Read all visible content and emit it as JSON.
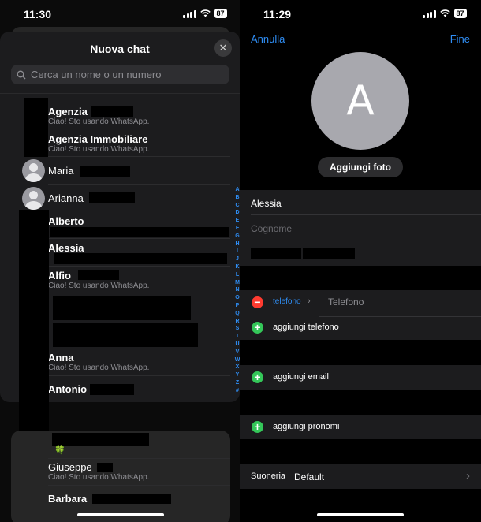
{
  "left_screen": {
    "status": {
      "time": "11:30",
      "battery": "87"
    },
    "sheet": {
      "title": "Nuova chat",
      "close_symbol": "✕",
      "search_placeholder": "Cerca un nome o un numero"
    },
    "contacts": [
      {
        "name": "Agenzia",
        "status": "Ciao! Sto usando WhatsApp."
      },
      {
        "name": "Agenzia Immobiliare",
        "status": "Ciao! Sto usando WhatsApp."
      },
      {
        "name": "Maria"
      },
      {
        "name": "Arianna"
      },
      {
        "name": "Alberto"
      },
      {
        "name": "Alessia"
      },
      {
        "name": "Alfio",
        "status": "Ciao! Sto usando WhatsApp."
      },
      {
        "name": "Anna",
        "status": "Ciao! Sto usando WhatsApp."
      },
      {
        "name": "Antonio"
      }
    ],
    "index_letters": [
      "A",
      "B",
      "C",
      "D",
      "E",
      "F",
      "G",
      "H",
      "I",
      "J",
      "K",
      "L",
      "M",
      "N",
      "O",
      "P",
      "Q",
      "R",
      "S",
      "T",
      "U",
      "V",
      "W",
      "X",
      "Y",
      "Z",
      "#"
    ],
    "below": [
      {
        "name": "Giuseppe",
        "status": "Ciao! Sto usando WhatsApp."
      },
      {
        "name": "Barbara"
      }
    ],
    "clover_emoji": "🍀"
  },
  "right_screen": {
    "status": {
      "time": "11:29",
      "battery": "87"
    },
    "nav": {
      "cancel": "Annulla",
      "done": "Fine"
    },
    "avatar_initial": "A",
    "add_photo": "Aggiungi foto",
    "first_name": "Alessia",
    "last_name_placeholder": "Cognome",
    "phone": {
      "label": "telefono",
      "placeholder": "Telefono"
    },
    "add_phone": "aggiungi telefono",
    "add_email": "aggiungi email",
    "add_pronouns": "aggiungi pronomi",
    "ringtone": {
      "label": "Suoneria",
      "value": "Default"
    }
  },
  "colors": {
    "accent": "#2f8ef5",
    "add": "#34c759",
    "remove": "#ff3b30"
  }
}
